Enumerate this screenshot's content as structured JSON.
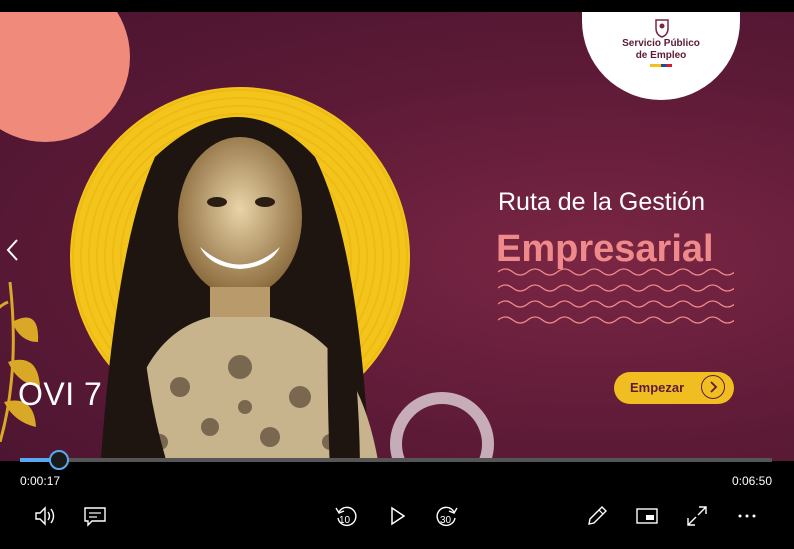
{
  "video": {
    "logo": {
      "line1": "Servicio Público",
      "line2": "de Empleo"
    },
    "title_line1": "Ruta de la Gestión",
    "title_line2": "Empresarial",
    "start_button_label": "Empezar",
    "overlay_title": "OVI 7"
  },
  "player": {
    "current_time": "0:00:17",
    "total_time": "0:06:50",
    "progress_fraction": 0.052,
    "skip_back_seconds": "10",
    "skip_forward_seconds": "30",
    "controls": [
      "volume-icon",
      "subtitles-icon",
      "skip-back-10-icon",
      "play-icon",
      "skip-forward-30-icon",
      "edit-icon",
      "mini-view-icon",
      "fullscreen-icon",
      "more-icon"
    ]
  },
  "colors": {
    "background": "#5c1a36",
    "accent_yellow": "#f0be20",
    "accent_coral": "#f08a8a",
    "progress": "#5aa9f0"
  }
}
